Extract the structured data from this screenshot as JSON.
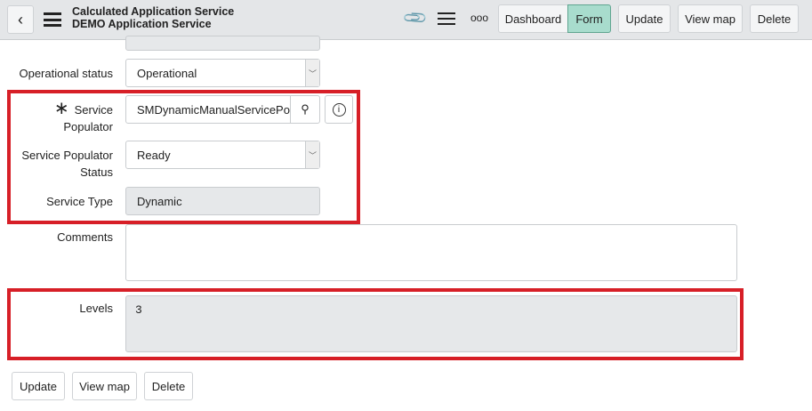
{
  "header": {
    "title": "Calculated Application Service",
    "subtitle": "DEMO Application Service",
    "buttons": {
      "dashboard": "Dashboard",
      "form": "Form",
      "update": "Update",
      "view_map": "View map",
      "delete": "Delete"
    },
    "more": "ooo"
  },
  "form": {
    "operational_status": {
      "label": "Operational status",
      "value": "Operational"
    },
    "service_populator": {
      "label_line1": "Service",
      "label_line2": "Populator",
      "value": "SMDynamicManualServicePopulator",
      "required_mark": "∗"
    },
    "service_populator_status": {
      "label_line1": "Service Populator",
      "label_line2": "Status",
      "value": "Ready"
    },
    "service_type": {
      "label": "Service Type",
      "value": "Dynamic"
    },
    "comments": {
      "label": "Comments",
      "value": ""
    },
    "levels": {
      "label": "Levels",
      "value": "3"
    }
  },
  "footer": {
    "update": "Update",
    "view_map": "View map",
    "delete": "Delete"
  },
  "colors": {
    "highlight": "#d71f27",
    "form_active": "#a8dccd"
  }
}
